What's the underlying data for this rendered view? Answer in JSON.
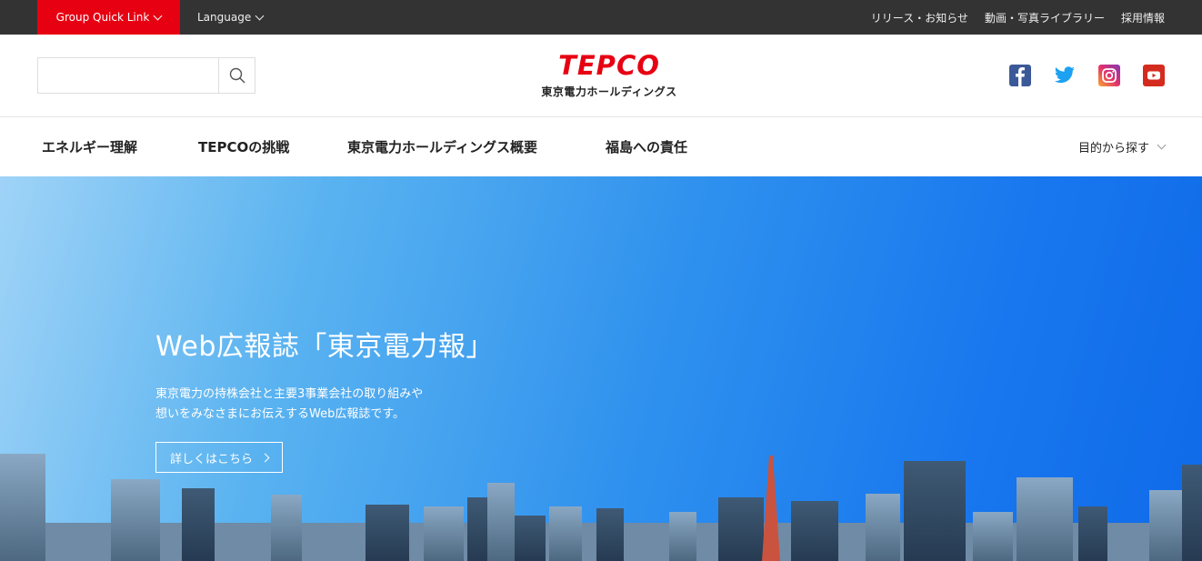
{
  "topbar": {
    "group_quick_link": "Group Quick Link",
    "language": "Language",
    "links": [
      "リリース・お知らせ",
      "動画・写真ライブラリー",
      "採用情報"
    ]
  },
  "header": {
    "search_placeholder": "",
    "logo_mark": "TEPCO",
    "logo_sub": "東京電力ホールディングス",
    "social": [
      "facebook-icon",
      "twitter-icon",
      "instagram-icon",
      "youtube-icon"
    ],
    "colors": {
      "brand_red": "#e60012",
      "facebook": "#3b5998",
      "twitter": "#1da1f2",
      "youtube": "#d52b1e"
    }
  },
  "nav": {
    "items": [
      "エネルギー理解",
      "TEPCOの挑戦",
      "東京電力ホールディングス概要",
      "福島への責任"
    ],
    "find_label": "目的から探す"
  },
  "hero": {
    "title": "Web広報誌「東京電力報」",
    "desc_line1": "東京電力の持株会社と主要3事業会社の取り組みや",
    "desc_line2": "想いをみなさまにお伝えするWeb広報誌です。",
    "button_label": "詳しくはこちら"
  }
}
